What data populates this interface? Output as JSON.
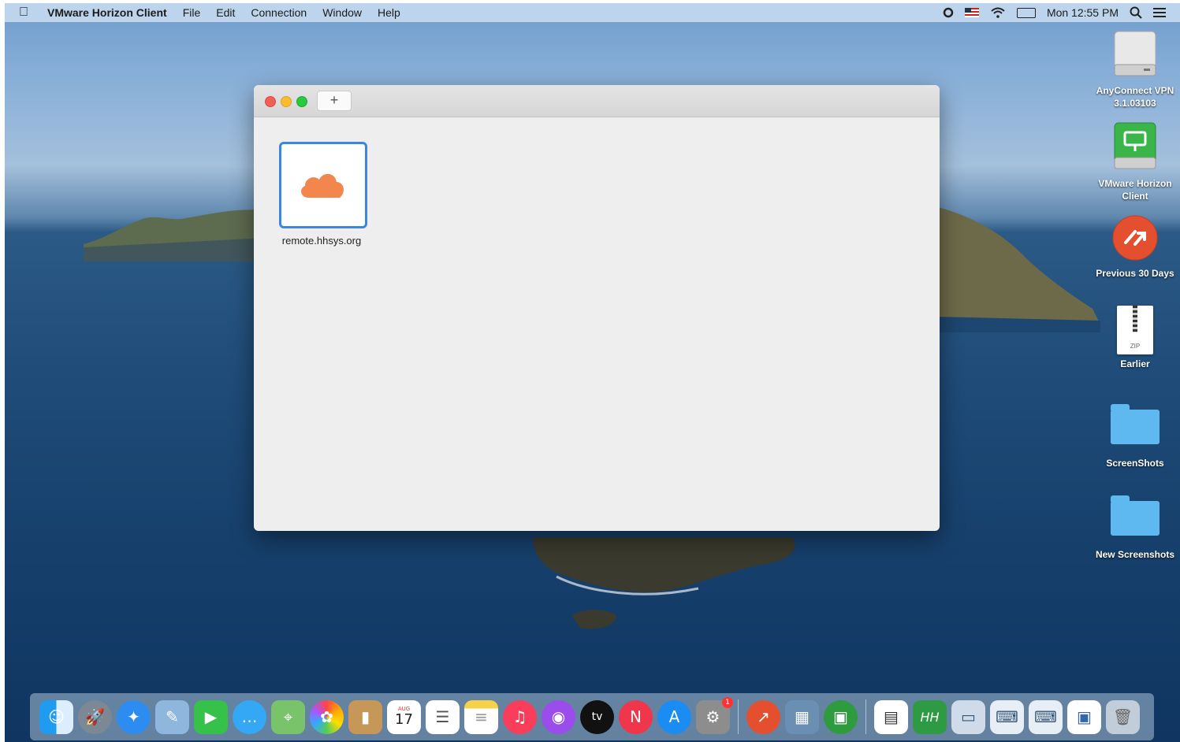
{
  "menubar": {
    "app_name": "VMware Horizon Client",
    "menus": [
      "File",
      "Edit",
      "Connection",
      "Window",
      "Help"
    ],
    "clock": "Mon 12:55 PM",
    "icons": [
      "apple-icon",
      "record-icon",
      "flag-icon",
      "wifi-icon",
      "battery-icon",
      "search-icon",
      "list-icon"
    ]
  },
  "window": {
    "add_button": "+",
    "servers": [
      {
        "label": "remote.hhsys.org"
      }
    ]
  },
  "desktop_icons": [
    {
      "label": "AnyConnect VPN 3.1.03103"
    },
    {
      "label": "VMware Horizon Client"
    },
    {
      "label": "Previous 30 Days"
    },
    {
      "label": "Earlier",
      "sub": "ZIP"
    },
    {
      "label": "ScreenShots"
    },
    {
      "label": "New Screenshots"
    }
  ],
  "dock": {
    "calendar_month": "AUG",
    "calendar_day": "17",
    "tv_label": "tv",
    "settings_badge": "1"
  }
}
